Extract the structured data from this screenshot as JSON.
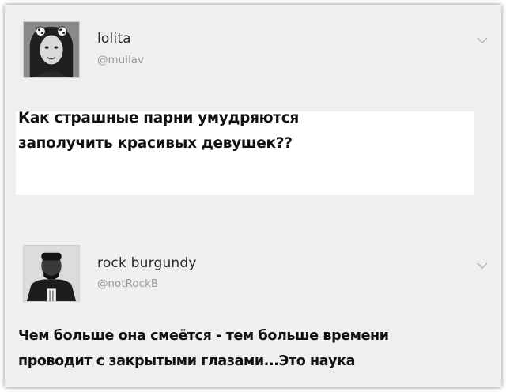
{
  "tweets": [
    {
      "name": "lolita",
      "handle": "@muilav",
      "text_line1": "Как страшные парни умудряются",
      "text_line2": "заполучить красивых девушек??",
      "avatar_icon": "user-avatar-icon",
      "menu_icon": "chevron-down-icon"
    },
    {
      "name": "rock burgundy",
      "handle": "@notRockB",
      "text_line1": "Чем больше она смеётся - тем больше времени",
      "text_line2": "проводит с закрытыми глазами...Это наука",
      "avatar_icon": "user-avatar-icon",
      "menu_icon": "chevron-down-icon"
    }
  ],
  "colors": {
    "background": "#efefef",
    "name": "#2a2a2a",
    "handle": "#9a9a9a",
    "text": "#111111"
  }
}
